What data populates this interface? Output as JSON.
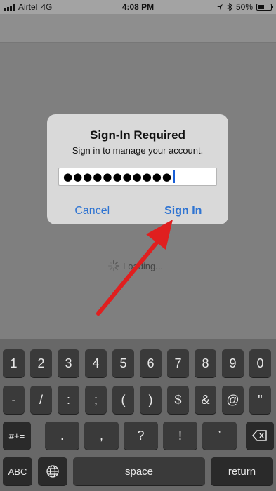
{
  "status_bar": {
    "carrier": "Airtel",
    "network": "4G",
    "time": "4:08 PM",
    "battery": "50%",
    "battery_level": 0.5
  },
  "loading": {
    "text": "Loading..."
  },
  "dialog": {
    "title": "Sign-In Required",
    "message": "Sign in to manage your account.",
    "password_mask": "●●●●●●●●●●●",
    "cancel_label": "Cancel",
    "sign_in_label": "Sign In"
  },
  "keyboard": {
    "row1": [
      "1",
      "2",
      "3",
      "4",
      "5",
      "6",
      "7",
      "8",
      "9",
      "0"
    ],
    "row2": [
      "-",
      "/",
      ":",
      ";",
      "(",
      ")",
      "$",
      "&",
      "@",
      "\""
    ],
    "row3": [
      ".",
      ",",
      "?",
      "!",
      "’"
    ],
    "symbols_label": "#+=",
    "abc_label": "ABC",
    "space_label": "space",
    "return_label": "return"
  },
  "colors": {
    "accent": "#2f74d2",
    "arrow": "#e01f1f"
  }
}
